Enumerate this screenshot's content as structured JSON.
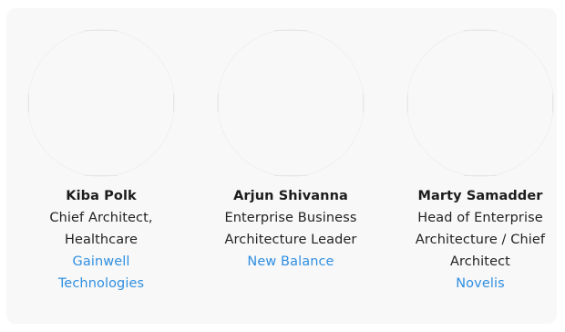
{
  "speakers": [
    {
      "name": "Kiba Polk",
      "title": "Chief Architect, Healthcare",
      "company": "Gainwell Technologies"
    },
    {
      "name": "Arjun Shivanna",
      "title": "Enterprise Business Architecture Leader",
      "company": "New Balance"
    },
    {
      "name": "Marty Samadder",
      "title": "Head of Enterprise Architecture / Chief Architect",
      "company": "Novelis"
    }
  ],
  "colors": {
    "panel_background": "#f8f8f9",
    "name_text": "#1c1c1c",
    "title_text": "#222222",
    "company_link": "#2f8fe0"
  }
}
